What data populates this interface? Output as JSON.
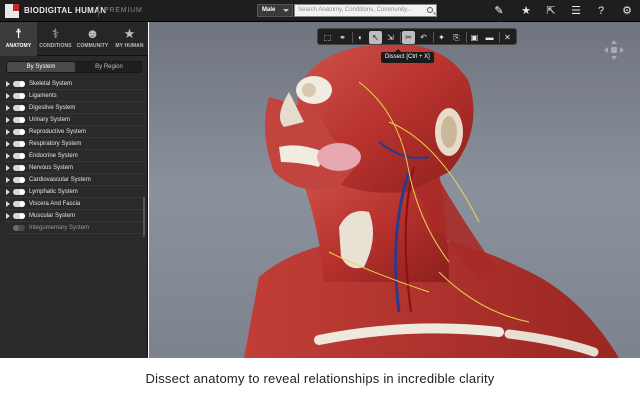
{
  "header": {
    "brand": "BIODIGITAL HUMAN",
    "tier": "PREMIUM",
    "gender_value": "Male",
    "search_placeholder": "Search Anatomy, Conditions, Community...",
    "icons": [
      "pencil-icon",
      "star-icon",
      "share-icon",
      "checklist-icon",
      "help-icon",
      "gear-icon"
    ],
    "icon_glyphs": [
      "✎",
      "★",
      "⇱",
      "☰",
      "?",
      "⚙"
    ]
  },
  "sidebar": {
    "tabs": [
      {
        "label": "ANATOMY",
        "glyph": "☨",
        "icon": "figure-icon",
        "active": true
      },
      {
        "label": "CONDITIONS",
        "glyph": "⚕",
        "icon": "stethoscope-icon",
        "active": false
      },
      {
        "label": "COMMUNITY",
        "glyph": "☻",
        "icon": "community-icon",
        "active": false
      },
      {
        "label": "MY HUMAN",
        "glyph": "★",
        "icon": "star-icon",
        "active": false
      }
    ],
    "subtabs": [
      {
        "label": "By System",
        "active": true
      },
      {
        "label": "By Region",
        "active": false
      }
    ],
    "systems": [
      {
        "name": "Skeletal System",
        "on": true
      },
      {
        "name": "Ligaments",
        "on": true
      },
      {
        "name": "Digestive System",
        "on": true
      },
      {
        "name": "Urinary System",
        "on": true
      },
      {
        "name": "Reproductive System",
        "on": true
      },
      {
        "name": "Respiratory System",
        "on": true
      },
      {
        "name": "Endocrine System",
        "on": true
      },
      {
        "name": "Nervous System",
        "on": true
      },
      {
        "name": "Cardiovascular System",
        "on": true
      },
      {
        "name": "Lymphatic System",
        "on": true
      },
      {
        "name": "Viscera And Fascia",
        "on": true
      },
      {
        "name": "Muscular System",
        "on": true
      },
      {
        "name": "Integumentary System",
        "on": false
      }
    ]
  },
  "viewer": {
    "tools": [
      {
        "glyph": "⬚",
        "icon": "box-icon"
      },
      {
        "glyph": "⚭",
        "icon": "lungs-icon"
      },
      {
        "glyph": "◐",
        "icon": "half-circle-icon"
      },
      {
        "glyph": "↖",
        "icon": "select-icon",
        "selected": true
      },
      {
        "glyph": "⇲",
        "icon": "select-multiple-icon"
      },
      {
        "glyph": "✂",
        "icon": "dissect-icon",
        "selected": true
      },
      {
        "glyph": "↶",
        "icon": "undo-icon"
      },
      {
        "glyph": "✦",
        "icon": "pin-icon"
      },
      {
        "glyph": "⎘",
        "icon": "copy-icon"
      },
      {
        "glyph": "▣",
        "icon": "camera-icon"
      },
      {
        "glyph": "▬",
        "icon": "panel-icon"
      },
      {
        "glyph": "✕",
        "icon": "reset-icon"
      }
    ],
    "tooltip": "Dissect [Ctrl + X]"
  },
  "caption": "Dissect anatomy to reveal relationships in incredible clarity",
  "colors": {
    "topbar": "#1e1e1e",
    "sidebar": "#2a2a2a",
    "muscle": "#b8322e",
    "background": "#7d838e",
    "logo_red": "#c8262a"
  }
}
